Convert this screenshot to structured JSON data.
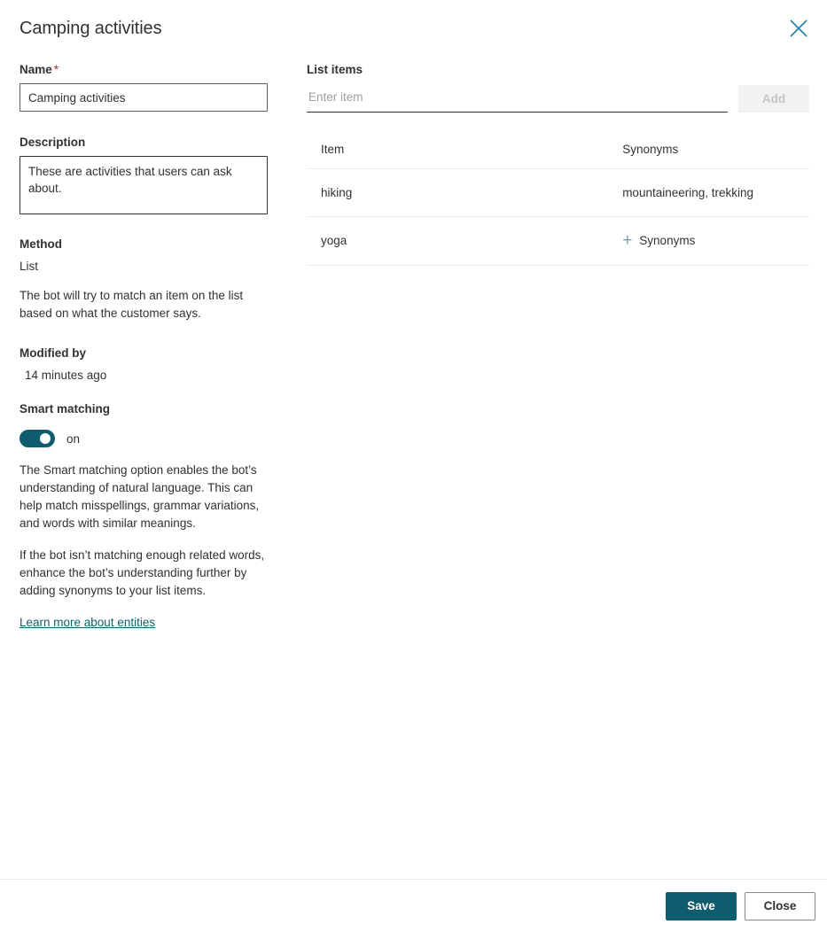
{
  "header": {
    "title": "Camping activities",
    "close_icon": "close-icon"
  },
  "left": {
    "name": {
      "label": "Name",
      "required_marker": "*",
      "value": "Camping activities",
      "placeholder": ""
    },
    "description": {
      "label": "Description",
      "value": "These are activities that users can ask about.",
      "placeholder": ""
    },
    "method": {
      "label": "Method",
      "value": "List",
      "helper": "The bot will try to match an item on the list based on what the customer says."
    },
    "modified": {
      "label": "Modified by",
      "value": "14 minutes ago"
    },
    "smart_matching": {
      "label": "Smart matching",
      "toggle_state": "on",
      "paragraph_1": "The Smart matching option enables the bot’s understanding of natural language. This can help match misspellings, grammar variations, and words with similar meanings.",
      "paragraph_2": "If the bot isn’t matching enough related words, enhance the bot’s understanding further by adding synonyms to your list items.",
      "link_text": "Learn more about entities"
    }
  },
  "right": {
    "list_items_label": "List items",
    "input_placeholder": "Enter item",
    "input_value": "",
    "add_button": "Add",
    "table": {
      "columns": [
        "Item",
        "Synonyms"
      ],
      "rows": [
        {
          "item": "hiking",
          "synonyms": "mountaineering, trekking",
          "has_add": false
        },
        {
          "item": "yoga",
          "synonyms": "Synonyms",
          "has_add": true
        }
      ]
    }
  },
  "footer": {
    "save_label": "Save",
    "close_label": "Close"
  },
  "colors": {
    "accent_teal": "#0f5c6e",
    "link_teal": "#115e6d",
    "close_icon_blue": "#1f7fa0",
    "required_red": "#a4262c",
    "plus_icon": "#7a9fab"
  }
}
